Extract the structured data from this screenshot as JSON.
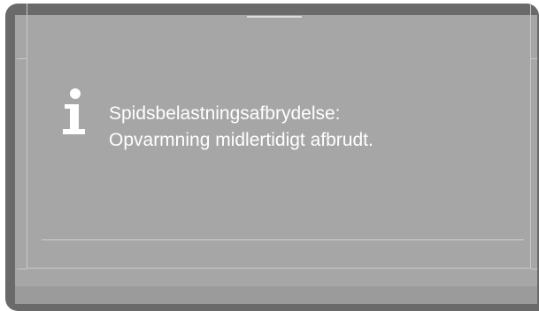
{
  "message": {
    "line1": "Spidsbelastningsafbrydelse:",
    "line2": "Opvarmning midlertidigt afbrudt."
  },
  "icons": {
    "info": "info-icon"
  },
  "colors": {
    "bezel": "#6a6a6a",
    "screen": "#a6a6a6",
    "text": "#ffffff"
  }
}
